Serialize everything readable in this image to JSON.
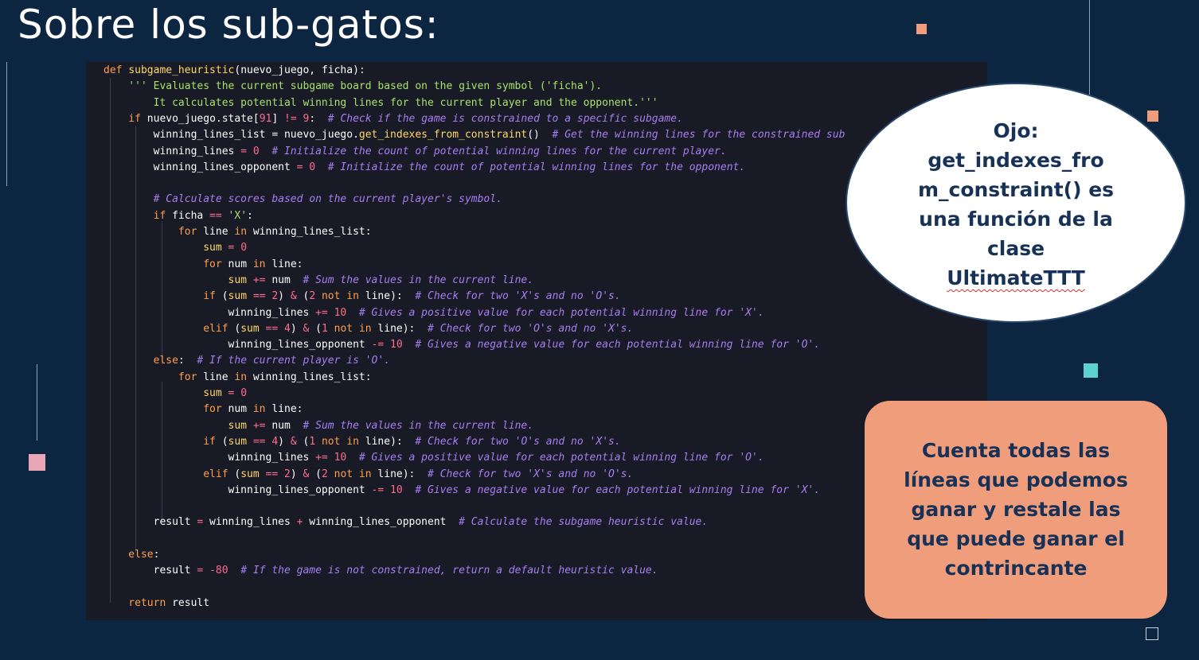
{
  "slide": {
    "title": "Sobre los sub-gatos:"
  },
  "colors": {
    "background": "#0c2641",
    "code_bg": "#181a26",
    "accent_orange": "#f09d7c",
    "accent_teal": "#5ed1d2",
    "accent_pink": "#e8a6b6",
    "text_dark": "#173256"
  },
  "code": {
    "lines": [
      [
        [
          "kw",
          "def "
        ],
        [
          "fn",
          "subgame_heuristic"
        ],
        [
          "t",
          "(nuevo_juego, ficha):"
        ]
      ],
      [
        [
          "st",
          "    ''' Evaluates the current subgame board based on the given symbol ('ficha').\n"
        ]
      ],
      [
        [
          "st",
          "        It calculates potential winning lines for the current player and the opponent.'''"
        ]
      ],
      [
        [
          "kw",
          "    if "
        ],
        [
          "t",
          "nuevo_juego.state["
        ],
        [
          "nm",
          "91"
        ],
        [
          "t",
          "] "
        ],
        [
          "op",
          "!="
        ],
        [
          "t",
          " "
        ],
        [
          "nm",
          "9"
        ],
        [
          "t",
          ":  "
        ],
        [
          "cm",
          "# Check if the game is constrained to a specific subgame."
        ]
      ],
      [
        [
          "t",
          "        winning_lines_list = nuevo_juego."
        ],
        [
          "fn",
          "get_indexes_from_constraint"
        ],
        [
          "t",
          "()  "
        ],
        [
          "cm",
          "# Get the winning lines for the constrained sub"
        ]
      ],
      [
        [
          "t",
          "        winning_lines "
        ],
        [
          "op",
          "="
        ],
        [
          "t",
          " "
        ],
        [
          "nm",
          "0"
        ],
        [
          "t",
          "  "
        ],
        [
          "cm",
          "# Initialize the count of potential winning lines for the current player."
        ]
      ],
      [
        [
          "t",
          "        winning_lines_opponent "
        ],
        [
          "op",
          "="
        ],
        [
          "t",
          " "
        ],
        [
          "nm",
          "0"
        ],
        [
          "t",
          "  "
        ],
        [
          "cm",
          "# Initialize the count of potential winning lines for the opponent."
        ]
      ],
      [
        [
          "t",
          ""
        ]
      ],
      [
        [
          "cm",
          "        # Calculate scores based on the current player's symbol."
        ]
      ],
      [
        [
          "kw",
          "        if "
        ],
        [
          "t",
          "ficha "
        ],
        [
          "op",
          "=="
        ],
        [
          "t",
          " "
        ],
        [
          "st",
          "'X'"
        ],
        [
          "t",
          ":"
        ]
      ],
      [
        [
          "kw",
          "            for "
        ],
        [
          "t",
          "line "
        ],
        [
          "kw",
          "in "
        ],
        [
          "t",
          "winning_lines_list:"
        ]
      ],
      [
        [
          "fn",
          "                sum "
        ],
        [
          "op",
          "="
        ],
        [
          "t",
          " "
        ],
        [
          "nm",
          "0"
        ]
      ],
      [
        [
          "kw",
          "                for "
        ],
        [
          "t",
          "num "
        ],
        [
          "kw",
          "in "
        ],
        [
          "t",
          "line:"
        ]
      ],
      [
        [
          "fn",
          "                    sum "
        ],
        [
          "op",
          "+="
        ],
        [
          "t",
          " num  "
        ],
        [
          "cm",
          "# Sum the values in the current line."
        ]
      ],
      [
        [
          "kw",
          "                if "
        ],
        [
          "t",
          "("
        ],
        [
          "fn",
          "sum"
        ],
        [
          "t",
          " "
        ],
        [
          "op",
          "=="
        ],
        [
          "t",
          " "
        ],
        [
          "nm",
          "2"
        ],
        [
          "t",
          ") "
        ],
        [
          "op",
          "&"
        ],
        [
          "t",
          " ("
        ],
        [
          "nm",
          "2"
        ],
        [
          "kw",
          " not in "
        ],
        [
          "t",
          "line):  "
        ],
        [
          "cm",
          "# Check for two 'X's and no 'O's."
        ]
      ],
      [
        [
          "t",
          "                    winning_lines "
        ],
        [
          "op",
          "+="
        ],
        [
          "t",
          " "
        ],
        [
          "nm",
          "10"
        ],
        [
          "t",
          "  "
        ],
        [
          "cm",
          "# Gives a positive value for each potential winning line for 'X'."
        ]
      ],
      [
        [
          "kw",
          "                elif "
        ],
        [
          "t",
          "("
        ],
        [
          "fn",
          "sum"
        ],
        [
          "t",
          " "
        ],
        [
          "op",
          "=="
        ],
        [
          "t",
          " "
        ],
        [
          "nm",
          "4"
        ],
        [
          "t",
          ") "
        ],
        [
          "op",
          "&"
        ],
        [
          "t",
          " ("
        ],
        [
          "nm",
          "1"
        ],
        [
          "kw",
          " not in "
        ],
        [
          "t",
          "line):  "
        ],
        [
          "cm",
          "# Check for two 'O's and no 'X's."
        ]
      ],
      [
        [
          "t",
          "                    winning_lines_opponent "
        ],
        [
          "op",
          "-="
        ],
        [
          "t",
          " "
        ],
        [
          "nm",
          "10"
        ],
        [
          "t",
          "  "
        ],
        [
          "cm",
          "# Gives a negative value for each potential winning line for 'O'."
        ]
      ],
      [
        [
          "kw",
          "        else"
        ],
        [
          "t",
          ":  "
        ],
        [
          "cm",
          "# If the current player is 'O'."
        ]
      ],
      [
        [
          "kw",
          "            for "
        ],
        [
          "t",
          "line "
        ],
        [
          "kw",
          "in "
        ],
        [
          "t",
          "winning_lines_list:"
        ]
      ],
      [
        [
          "fn",
          "                sum "
        ],
        [
          "op",
          "="
        ],
        [
          "t",
          " "
        ],
        [
          "nm",
          "0"
        ]
      ],
      [
        [
          "kw",
          "                for "
        ],
        [
          "t",
          "num "
        ],
        [
          "kw",
          "in "
        ],
        [
          "t",
          "line:"
        ]
      ],
      [
        [
          "fn",
          "                    sum "
        ],
        [
          "op",
          "+="
        ],
        [
          "t",
          " num  "
        ],
        [
          "cm",
          "# Sum the values in the current line."
        ]
      ],
      [
        [
          "kw",
          "                if "
        ],
        [
          "t",
          "("
        ],
        [
          "fn",
          "sum"
        ],
        [
          "t",
          " "
        ],
        [
          "op",
          "=="
        ],
        [
          "t",
          " "
        ],
        [
          "nm",
          "4"
        ],
        [
          "t",
          ") "
        ],
        [
          "op",
          "&"
        ],
        [
          "t",
          " ("
        ],
        [
          "nm",
          "1"
        ],
        [
          "kw",
          " not in "
        ],
        [
          "t",
          "line):  "
        ],
        [
          "cm",
          "# Check for two 'O's and no 'X's."
        ]
      ],
      [
        [
          "t",
          "                    winning_lines "
        ],
        [
          "op",
          "+="
        ],
        [
          "t",
          " "
        ],
        [
          "nm",
          "10"
        ],
        [
          "t",
          "  "
        ],
        [
          "cm",
          "# Gives a positive value for each potential winning line for 'O'."
        ]
      ],
      [
        [
          "kw",
          "                elif "
        ],
        [
          "t",
          "("
        ],
        [
          "fn",
          "sum"
        ],
        [
          "t",
          " "
        ],
        [
          "op",
          "=="
        ],
        [
          "t",
          " "
        ],
        [
          "nm",
          "2"
        ],
        [
          "t",
          ") "
        ],
        [
          "op",
          "&"
        ],
        [
          "t",
          " ("
        ],
        [
          "nm",
          "2"
        ],
        [
          "kw",
          " not in "
        ],
        [
          "t",
          "line):  "
        ],
        [
          "cm",
          "# Check for two 'X's and no 'O's."
        ]
      ],
      [
        [
          "t",
          "                    winning_lines_opponent "
        ],
        [
          "op",
          "-="
        ],
        [
          "t",
          " "
        ],
        [
          "nm",
          "10"
        ],
        [
          "t",
          "  "
        ],
        [
          "cm",
          "# Gives a negative value for each potential winning line for 'X'."
        ]
      ],
      [
        [
          "t",
          ""
        ]
      ],
      [
        [
          "t",
          "        result "
        ],
        [
          "op",
          "="
        ],
        [
          "t",
          " winning_lines "
        ],
        [
          "op",
          "+"
        ],
        [
          "t",
          " winning_lines_opponent  "
        ],
        [
          "cm",
          "# Calculate the subgame heuristic value."
        ]
      ],
      [
        [
          "t",
          ""
        ]
      ],
      [
        [
          "kw",
          "    else"
        ],
        [
          "t",
          ":"
        ]
      ],
      [
        [
          "t",
          "        result "
        ],
        [
          "op",
          "="
        ],
        [
          "t",
          " "
        ],
        [
          "op",
          "-"
        ],
        [
          "nm",
          "80"
        ],
        [
          "t",
          "  "
        ],
        [
          "cm",
          "# If the game is not constrained, return a default heuristic value."
        ]
      ],
      [
        [
          "t",
          ""
        ]
      ],
      [
        [
          "kw",
          "    return "
        ],
        [
          "t",
          "result"
        ]
      ]
    ]
  },
  "callout_bubble": {
    "line1": "Ojo:",
    "line2": "get_indexes_fro",
    "line3": "m_constraint() es",
    "line4": "una función de la",
    "line5": "clase",
    "line6": "UltimateTTT"
  },
  "callout_card": {
    "line1": "Cuenta todas las",
    "line2": "líneas que podemos",
    "line3": "ganar y restale las",
    "line4": "que puede ganar el",
    "line5": "contrincante"
  }
}
